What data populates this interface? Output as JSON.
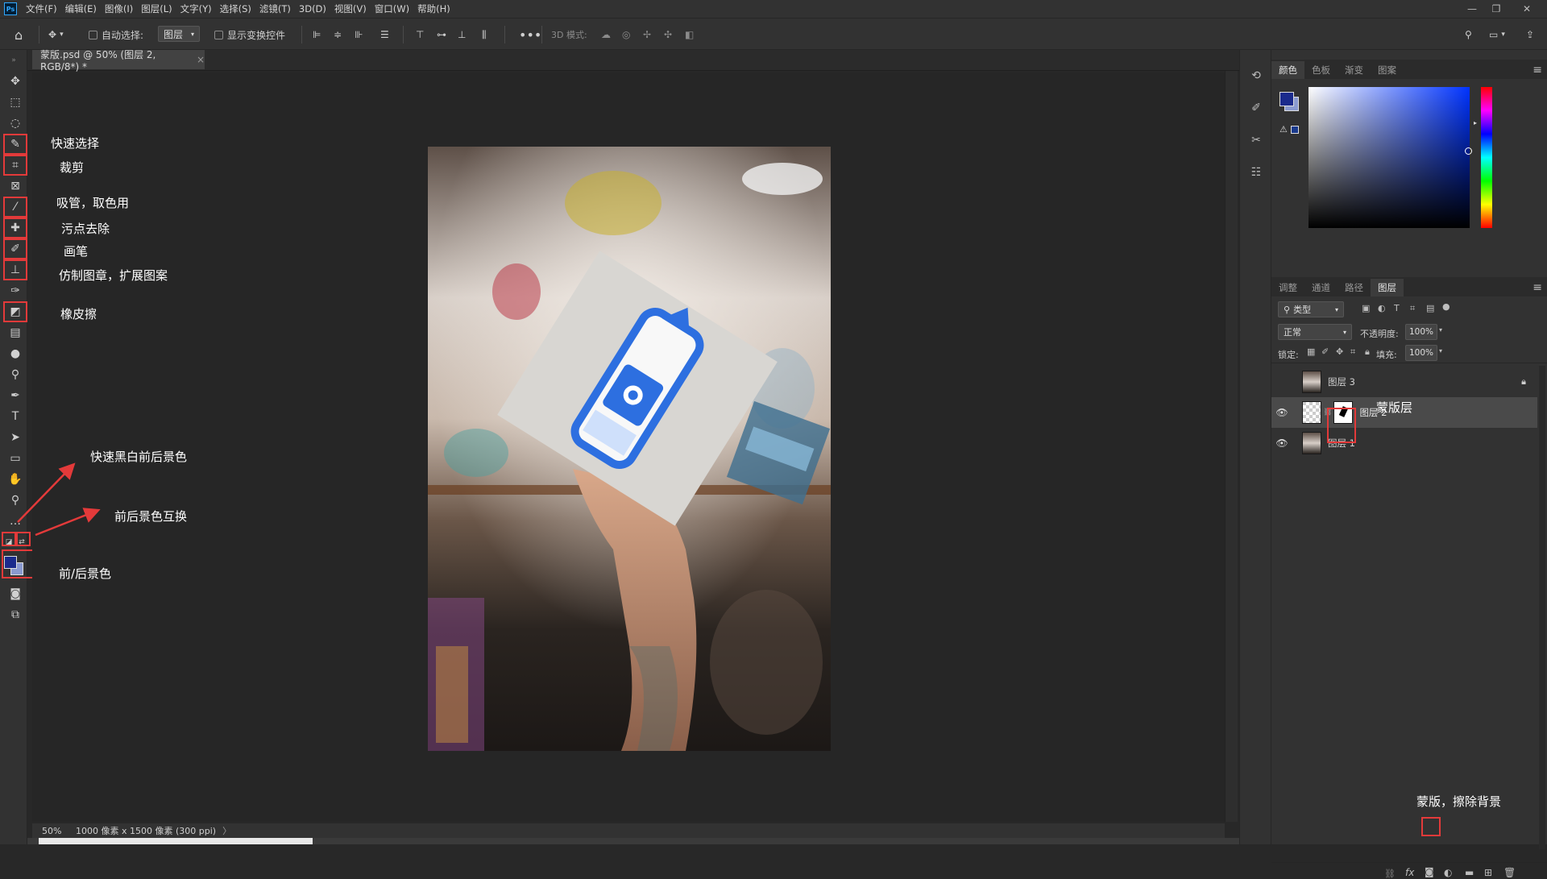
{
  "menubar": {
    "app_logo": "Ps",
    "items": [
      "文件(F)",
      "编辑(E)",
      "图像(I)",
      "图层(L)",
      "文字(Y)",
      "选择(S)",
      "滤镜(T)",
      "3D(D)",
      "视图(V)",
      "窗口(W)",
      "帮助(H)"
    ]
  },
  "options": {
    "auto_select_label": "自动选择:",
    "auto_select_value": "图层",
    "show_transform_label": "显示变换控件",
    "mode_3d_label": "3D 模式:"
  },
  "document": {
    "tab_title": "蒙版.psd @ 50% (图层 2, RGB/8*) *"
  },
  "status": {
    "zoom": "50%",
    "doc_info": "1000 像素 x 1500 像素 (300 ppi)"
  },
  "colors": {
    "foreground": "#1a2a8c",
    "background": "#8a9ad0",
    "accent_red": "#e33a3a",
    "photo_badge_blue": "#2d6fe0"
  },
  "annotations": {
    "quick_select": "快速选择",
    "crop": "裁剪",
    "eyedropper": "吸管，取色用",
    "spot_heal": "污点去除",
    "brush": "画笔",
    "clone_stamp": "仿制图章，扩展图案",
    "eraser": "橡皮擦",
    "default_colors": "快速黑白前后景色",
    "swap_colors": "前后景色互换",
    "fg_bg_colors": "前/后景色",
    "mask_layer": "蒙版层",
    "add_mask": "蒙版，擦除背景"
  },
  "color_panel": {
    "tabs": [
      "颜色",
      "色板",
      "渐变",
      "图案"
    ],
    "active_tab": "颜色"
  },
  "layers_panel": {
    "tabs": [
      "调整",
      "通道",
      "路径",
      "图层"
    ],
    "active_tab": "图层",
    "filter_kind": "类型",
    "blend_mode": "正常",
    "opacity_label": "不透明度:",
    "opacity_value": "100%",
    "lock_label": "锁定:",
    "fill_label": "填充:",
    "fill_value": "100%",
    "layers": [
      {
        "name": "图层 3",
        "visible": false,
        "locked": true
      },
      {
        "name": "图层 2",
        "visible": true,
        "has_mask": true,
        "selected": true
      },
      {
        "name": "图层 1",
        "visible": true
      }
    ]
  }
}
